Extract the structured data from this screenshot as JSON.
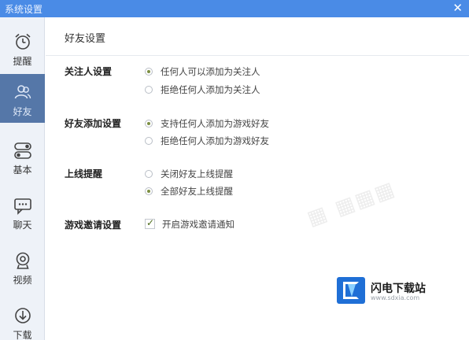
{
  "window": {
    "title": "系统设置",
    "close_glyph": "✕"
  },
  "sidebar": {
    "items": [
      {
        "label": "提醒",
        "icon": "alarm-clock-icon",
        "active": false
      },
      {
        "label": "好友",
        "icon": "friends-icon",
        "active": true
      },
      {
        "label": "基本",
        "icon": "toggle-switches-icon",
        "active": false
      },
      {
        "label": "聊天",
        "icon": "chat-bubble-icon",
        "active": false
      },
      {
        "label": "视频",
        "icon": "webcam-icon",
        "active": false
      },
      {
        "label": "下载",
        "icon": "download-icon",
        "active": false
      }
    ]
  },
  "main": {
    "title": "好友设置",
    "sections": [
      {
        "label": "关注人设置",
        "control": "radio",
        "options": [
          {
            "label": "任何人可以添加为关注人",
            "checked": true
          },
          {
            "label": "拒绝任何人添加为关注人",
            "checked": false
          }
        ]
      },
      {
        "label": "好友添加设置",
        "control": "radio",
        "options": [
          {
            "label": "支持任何人添加为游戏好友",
            "checked": true
          },
          {
            "label": "拒绝任何人添加为游戏好友",
            "checked": false
          }
        ]
      },
      {
        "label": "上线提醒",
        "control": "radio",
        "options": [
          {
            "label": "关闭好友上线提醒",
            "checked": false
          },
          {
            "label": "全部好友上线提醒",
            "checked": true
          }
        ]
      },
      {
        "label": "游戏邀请设置",
        "control": "checkbox",
        "options": [
          {
            "label": "开启游戏邀请通知",
            "checked": true
          }
        ]
      }
    ]
  },
  "watermark": {
    "brand": "闪电下载站",
    "url": "www.sdxia.com"
  },
  "colors": {
    "titlebar": "#4a8be6",
    "sidebar_active": "#5577a8",
    "radio_dot": "#7c8f42",
    "brand_blue": "#1f6fd6"
  }
}
